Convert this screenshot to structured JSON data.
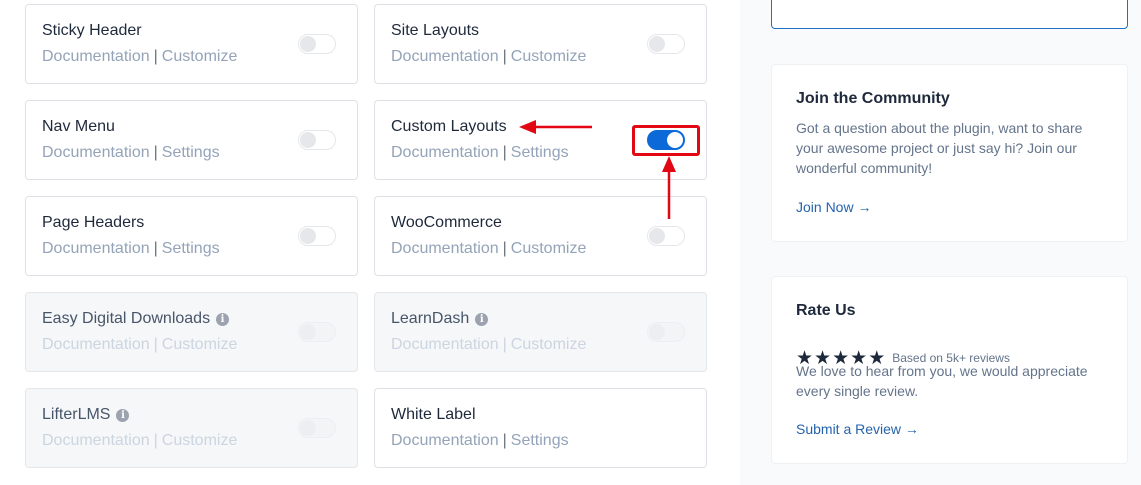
{
  "modules": [
    {
      "title": "Sticky Header",
      "link1": "Documentation",
      "sep": "|",
      "link2": "Customize",
      "enabled": false,
      "disabled": false,
      "info": false
    },
    {
      "title": "Site Layouts",
      "link1": "Documentation",
      "sep": "|",
      "link2": "Customize",
      "enabled": false,
      "disabled": false,
      "info": false
    },
    {
      "title": "Nav Menu",
      "link1": "Documentation",
      "sep": "|",
      "link2": "Settings",
      "enabled": false,
      "disabled": false,
      "info": false
    },
    {
      "title": "Custom Layouts",
      "link1": "Documentation",
      "sep": "|",
      "link2": "Settings",
      "enabled": true,
      "disabled": false,
      "info": false
    },
    {
      "title": "Page Headers",
      "link1": "Documentation",
      "sep": "|",
      "link2": "Settings",
      "enabled": false,
      "disabled": false,
      "info": false
    },
    {
      "title": "WooCommerce",
      "link1": "Documentation",
      "sep": "|",
      "link2": "Customize",
      "enabled": false,
      "disabled": false,
      "info": false
    },
    {
      "title": "Easy Digital Downloads",
      "link1": "Documentation",
      "sep": "|",
      "link2": "Customize",
      "enabled": false,
      "disabled": true,
      "info": true,
      "info_glyph": "i"
    },
    {
      "title": "LearnDash",
      "link1": "Documentation",
      "sep": "|",
      "link2": "Customize",
      "enabled": false,
      "disabled": true,
      "info": true,
      "info_glyph": "i"
    },
    {
      "title": "LifterLMS",
      "link1": "Documentation",
      "sep": "|",
      "link2": "Customize",
      "enabled": false,
      "disabled": true,
      "info": true,
      "info_glyph": "i"
    },
    {
      "title": "White Label",
      "link1": "Documentation",
      "sep": "|",
      "link2": "Settings",
      "enabled": false,
      "disabled": false,
      "info": false
    }
  ],
  "sidebar": {
    "community": {
      "title": "Join the Community",
      "text": "Got a question about the plugin, want to share your awesome project or just say hi? Join our wonderful community!",
      "link": "Join Now →"
    },
    "rate": {
      "title": "Rate Us",
      "stars": [
        "★",
        "★",
        "★",
        "★",
        "★"
      ],
      "rating": 5,
      "reviews_note": "Based on 5k+ reviews",
      "text": "We love to hear from you, we would appreciate every single review.",
      "link": "Submit a Review →"
    }
  },
  "annotation": {
    "color": "#e30613",
    "icons": [
      "arrow-left-icon",
      "arrow-up-icon"
    ]
  },
  "colors": {
    "toggle_on": "#0b6ad8",
    "link": "#2563ad",
    "text": "#1e293b",
    "muted": "#94a3b8"
  }
}
